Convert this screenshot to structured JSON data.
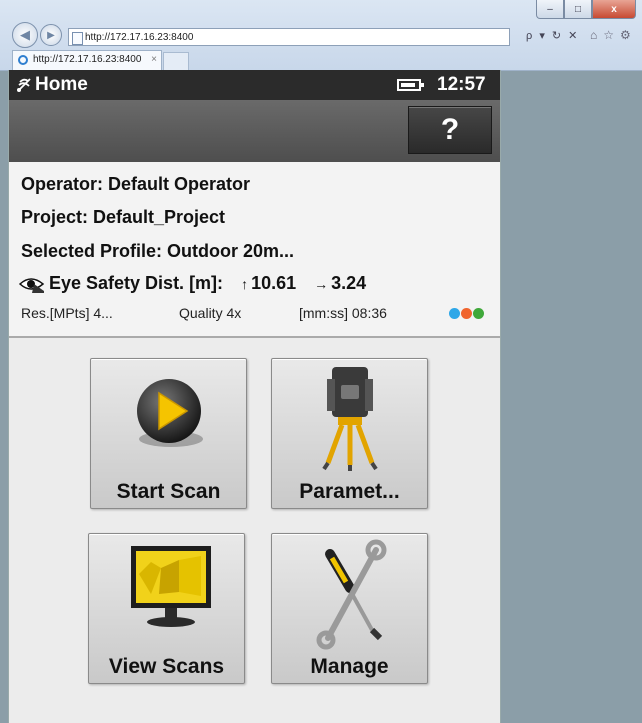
{
  "browser": {
    "address": "http://172.17.16.23:8400",
    "address_controls": "ρ ▾ ↻ ✕",
    "tab_title": "http://172.17.16.23:8400",
    "tab_close": "×",
    "window_controls": {
      "minimize": "–",
      "maximize": "□",
      "close": "x"
    },
    "toolbar_glyphs": "⌂☆⚙",
    "nav_glyphs": {
      "back": "◀",
      "forward": "▶"
    }
  },
  "app": {
    "screen_title": "Home",
    "clock": "12:57",
    "help_label": "?",
    "info": {
      "operator": "Operator: Default Operator",
      "project": "Project: Default_Project",
      "profile": "Selected Profile: Outdoor 20m...",
      "eye_safety_label": "Eye Safety Dist. [m]:",
      "eye_safety_up": "10.61",
      "eye_safety_right": "3.24",
      "up_arrow": "↑",
      "right_arrow": "→",
      "resolution": "Res.[MPts] 4...",
      "quality": "Quality 4x",
      "duration": "[mm:ss] 08:36"
    },
    "status_dot_colors": [
      "#2ea7e8",
      "#f0642d",
      "#3fa83a"
    ],
    "tiles": {
      "start_scan": "Start Scan",
      "parameters": "Paramet...",
      "view_scans": "View Scans",
      "manage": "Manage"
    },
    "icons": {
      "play": "play-icon",
      "scanner": "scanner-tripod-icon",
      "monitor": "monitor-icon",
      "tools": "tools-icon",
      "eye": "eye-laser-icon",
      "battery": "battery-icon"
    }
  }
}
